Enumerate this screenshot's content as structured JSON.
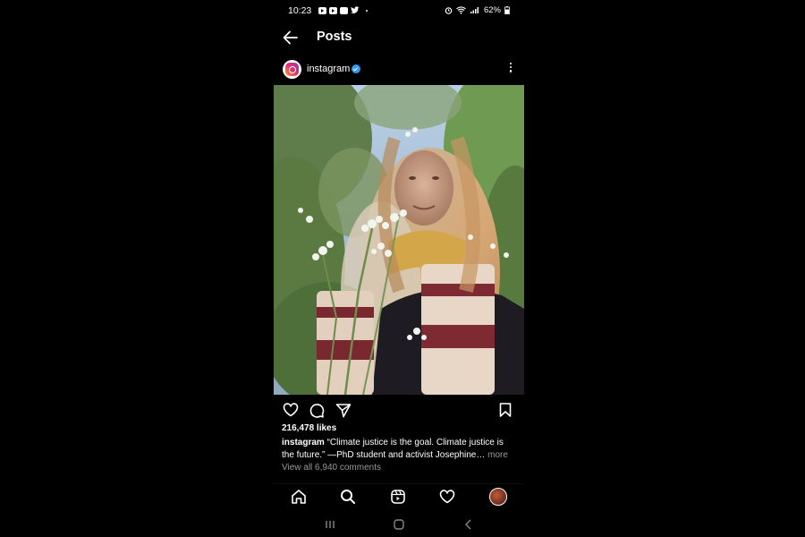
{
  "status_bar": {
    "time": "10:23",
    "battery": "62%",
    "icons": [
      "youtube-icon",
      "youtube-icon",
      "email-icon",
      "twitter-icon",
      "alarm-icon",
      "wifi-icon",
      "signal-icon",
      "battery-icon"
    ]
  },
  "header": {
    "title": "Posts",
    "back_icon": "arrow-left-icon"
  },
  "post": {
    "username": "instagram",
    "verified": true,
    "likes": "216,478 likes",
    "caption_user": "instagram",
    "caption_text": " “Climate justice is the goal. Climate justice is the future.” —PhD student and activist Josephine",
    "caption_ellipsis": "…",
    "caption_more": " more",
    "comments": "View all 6,940 comments"
  },
  "actions": [
    "heart-icon",
    "comment-icon",
    "share-icon",
    "bookmark-icon"
  ],
  "bottom_nav": [
    "home-icon",
    "search-icon",
    "reels-icon",
    "activity-heart-icon",
    "profile-avatar"
  ],
  "system_nav": [
    "recents-icon",
    "home-button-icon",
    "back-icon"
  ],
  "colors": {
    "background": "#000000",
    "verified_blue": "#3897f0",
    "muted_text": "#9a9a9a"
  }
}
